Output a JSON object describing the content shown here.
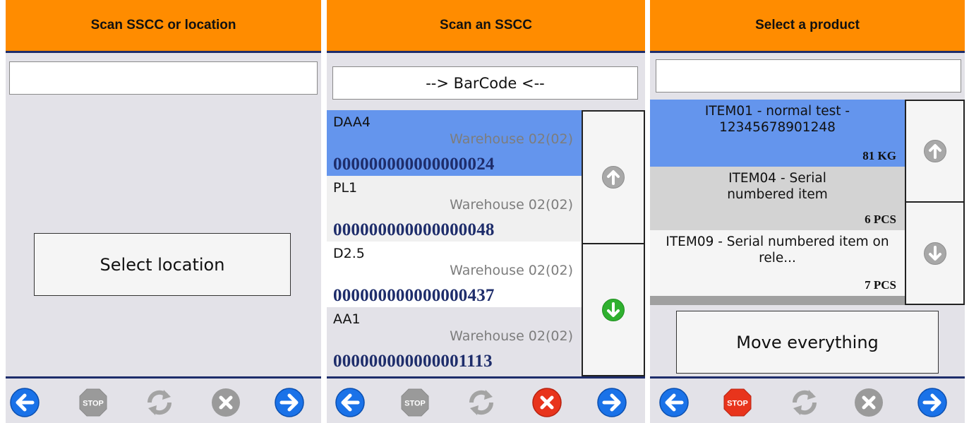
{
  "panel1": {
    "title": "Scan SSCC or location",
    "input_value": "",
    "select_location_label": "Select location"
  },
  "panel2": {
    "title": "Scan an SSCC",
    "input_value": "--> BarCode <--",
    "items": [
      {
        "code": "DAA4",
        "warehouse": "Warehouse 02(02)",
        "sscc": "000000000000000024",
        "selected": true
      },
      {
        "code": "PL1",
        "warehouse": "Warehouse 02(02)",
        "sscc": "000000000000000048",
        "selected": false
      },
      {
        "code": "D2.5",
        "warehouse": "Warehouse 02(02)",
        "sscc": "000000000000000437",
        "selected": false
      },
      {
        "code": "AA1",
        "warehouse": "Warehouse 02(02)",
        "sscc": "000000000000001113",
        "selected": false
      }
    ]
  },
  "panel3": {
    "title": "Select a product",
    "input_value": "",
    "products": [
      {
        "name": "ITEM01 - normal test - 12345678901248",
        "qty": "81 KG",
        "selected": true
      },
      {
        "name": "ITEM04 - Serial numbered item",
        "qty": "6 PCS",
        "selected": false
      },
      {
        "name": "ITEM09 - Serial numbered item on rele...",
        "qty": "7 PCS",
        "selected": false
      }
    ],
    "move_everything_label": "Move everything"
  },
  "footer_icons": {
    "back": "back-arrow-icon",
    "stop": "stop-icon",
    "stop_label": "STOP",
    "refresh": "refresh-icon",
    "cancel": "cancel-icon",
    "forward": "forward-arrow-icon"
  },
  "colors": {
    "header": "#ff8c00",
    "divider": "#1e2d6b",
    "selected_row": "#6495ed",
    "panel_bg": "#e3e2e8",
    "nav_blue": "#1a72e8",
    "stop_active": "#e8341c",
    "cancel_active": "#e8341c",
    "scroll_active": "#2fb02f",
    "disabled": "#9a9a9a"
  }
}
